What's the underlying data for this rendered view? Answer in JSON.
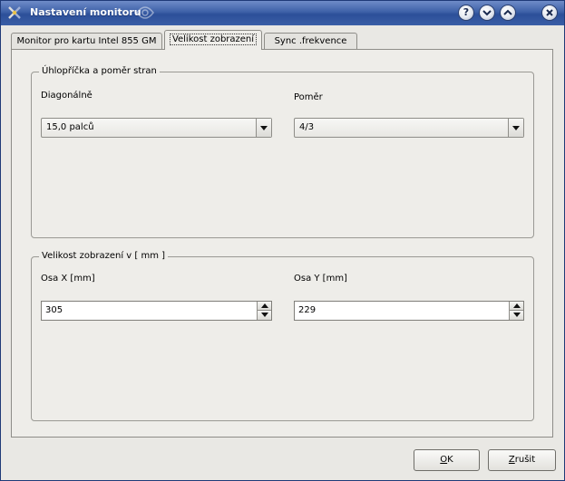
{
  "window": {
    "title": "Nastavení monitoru",
    "title_buttons": {
      "help": "?",
      "minimize": "⌄",
      "maximize": "⌃",
      "close": "×"
    }
  },
  "tabs": [
    {
      "label": "Monitor pro kartu Intel 855 GM",
      "active": false
    },
    {
      "label": "Velikost zobrazení",
      "active": true
    },
    {
      "label": "Sync .frekvence",
      "active": false
    }
  ],
  "diagonal_group": {
    "title": "Úhlopříčka a poměr stran",
    "diagonal_label": "Diagonálně",
    "diagonal_value": "15,0 palců",
    "ratio_label": "Poměr",
    "ratio_value": "4/3"
  },
  "size_group": {
    "title": "Velikost zobrazení v [ mm ]",
    "x_label": "Osa X [mm]",
    "x_value": "305",
    "y_label": "Osa Y [mm]",
    "y_value": "229"
  },
  "buttons": {
    "ok_first": "O",
    "ok_rest": "K",
    "cancel_first": "Z",
    "cancel_rest": "rušit"
  },
  "colors": {
    "titlebar": "#3e61a8",
    "window_bg": "#e9e8e4",
    "panel_bg": "#eeede9"
  }
}
